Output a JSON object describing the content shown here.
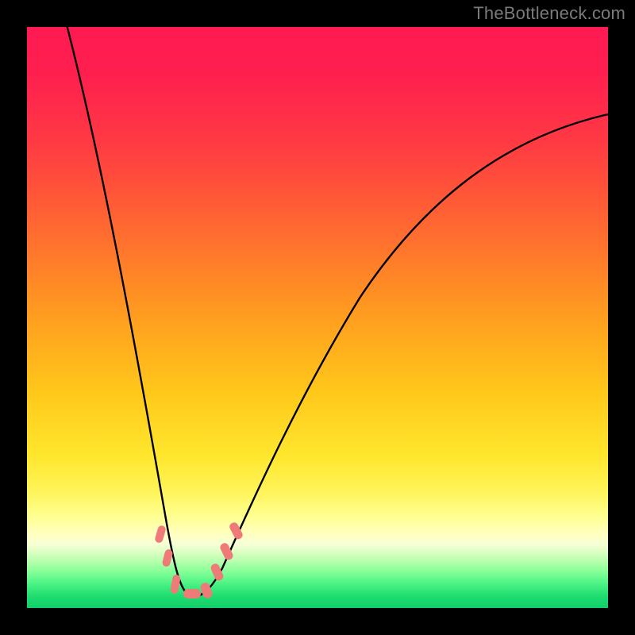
{
  "watermark": "TheBottleneck.com",
  "colors": {
    "frame": "#000000",
    "curve": "#000000",
    "marker_fill": "#ef7b78",
    "marker_stroke": "#ef7b78",
    "gradient_stops": [
      {
        "pos": 0.0,
        "hex": "#ff1a52"
      },
      {
        "pos": 0.5,
        "hex": "#ff9e1f"
      },
      {
        "pos": 0.8,
        "hex": "#fff45a"
      },
      {
        "pos": 0.9,
        "hex": "#d9ffc1"
      },
      {
        "pos": 1.0,
        "hex": "#10d068"
      }
    ]
  },
  "chart_data": {
    "type": "line",
    "title": "",
    "xlabel": "",
    "ylabel": "",
    "xlim": [
      0,
      100
    ],
    "ylim": [
      0,
      100
    ],
    "grid": false,
    "note": "Black curve is |bottleneck %| vs. relative component strength; minimum ≈ x=27. Values read from axis-less gradient plot, estimated to nearest few percent.",
    "series": [
      {
        "name": "bottleneck-curve",
        "x": [
          0,
          4,
          8,
          12,
          16,
          20,
          23,
          25,
          27,
          29,
          31,
          34,
          38,
          44,
          52,
          62,
          74,
          88,
          100
        ],
        "y": [
          120,
          100,
          80,
          60,
          42,
          26,
          14,
          7,
          2,
          5,
          11,
          20,
          32,
          45,
          57,
          67,
          75,
          81,
          85
        ]
      }
    ],
    "markers": [
      {
        "name": "low-band-left",
        "x": 22.5,
        "y": 12
      },
      {
        "name": "low-band-left2",
        "x": 23.8,
        "y": 7
      },
      {
        "name": "valley-left",
        "x": 25.5,
        "y": 2.5
      },
      {
        "name": "valley-mid",
        "x": 27.5,
        "y": 2
      },
      {
        "name": "valley-right",
        "x": 29.5,
        "y": 3
      },
      {
        "name": "rise-1",
        "x": 31.2,
        "y": 7
      },
      {
        "name": "rise-2",
        "x": 32.5,
        "y": 11
      },
      {
        "name": "rise-3",
        "x": 33.8,
        "y": 15
      }
    ]
  }
}
